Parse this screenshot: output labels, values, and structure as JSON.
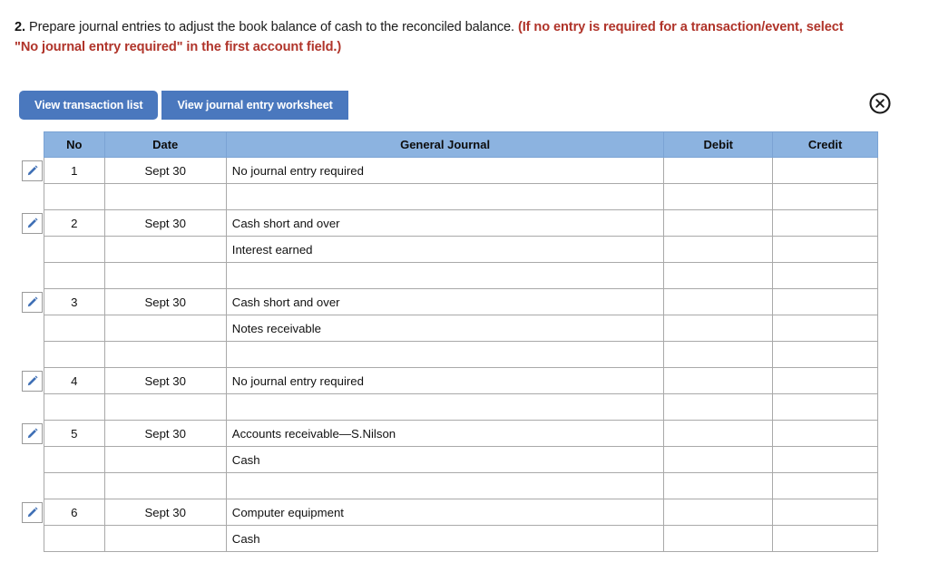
{
  "prompt": {
    "number": "2.",
    "main": " Prepare journal entries to adjust the book balance of cash to the reconciled balance. ",
    "note": "(If no entry is required for a transaction/event, select \"No journal entry required\" in the first account field.)"
  },
  "toolbar": {
    "view_transaction_list": "View transaction list",
    "view_journal_entry_worksheet": "View journal entry worksheet",
    "close_icon": "close-circle-icon",
    "edit_icon": "pencil-icon"
  },
  "colors": {
    "button_blue": "#4a78be",
    "header_blue": "#8cb3e0",
    "note_red": "#b0342a",
    "pencil_blue": "#3f6fb5",
    "grid_line": "#a9a9a9"
  },
  "table": {
    "columns": [
      "No",
      "Date",
      "General Journal",
      "Debit",
      "Credit"
    ],
    "rows": [
      {
        "type": "entry",
        "no": "1",
        "date": "Sept 30",
        "account": "No journal entry required",
        "debit": "",
        "credit": ""
      },
      {
        "type": "blank",
        "no": "",
        "date": "",
        "account": "",
        "debit": "",
        "credit": ""
      },
      {
        "type": "entry",
        "no": "2",
        "date": "Sept 30",
        "account": "Cash short and over",
        "debit": "",
        "credit": ""
      },
      {
        "type": "line",
        "no": "",
        "date": "",
        "account": "Interest earned",
        "debit": "",
        "credit": ""
      },
      {
        "type": "blank",
        "no": "",
        "date": "",
        "account": "",
        "debit": "",
        "credit": ""
      },
      {
        "type": "entry",
        "no": "3",
        "date": "Sept 30",
        "account": "Cash short and over",
        "debit": "",
        "credit": ""
      },
      {
        "type": "line",
        "no": "",
        "date": "",
        "account": "Notes receivable",
        "debit": "",
        "credit": ""
      },
      {
        "type": "blank",
        "no": "",
        "date": "",
        "account": "",
        "debit": "",
        "credit": ""
      },
      {
        "type": "entry",
        "no": "4",
        "date": "Sept 30",
        "account": "No journal entry required",
        "debit": "",
        "credit": ""
      },
      {
        "type": "blank",
        "no": "",
        "date": "",
        "account": "",
        "debit": "",
        "credit": ""
      },
      {
        "type": "entry",
        "no": "5",
        "date": "Sept 30",
        "account": "Accounts receivable—S.Nilson",
        "debit": "",
        "credit": ""
      },
      {
        "type": "line",
        "no": "",
        "date": "",
        "account": "Cash",
        "debit": "",
        "credit": ""
      },
      {
        "type": "blank",
        "no": "",
        "date": "",
        "account": "",
        "debit": "",
        "credit": ""
      },
      {
        "type": "entry",
        "no": "6",
        "date": "Sept 30",
        "account": "Computer equipment",
        "debit": "",
        "credit": ""
      },
      {
        "type": "line",
        "no": "",
        "date": "",
        "account": "Cash",
        "debit": "",
        "credit": ""
      }
    ]
  }
}
